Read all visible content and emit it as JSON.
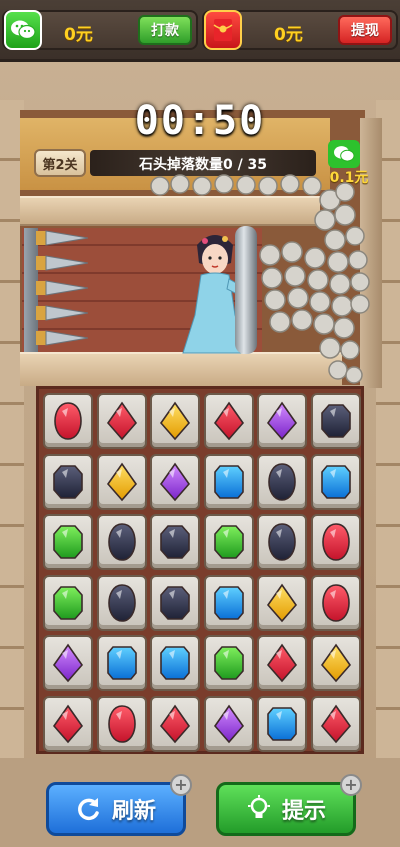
{
  "topbar": {
    "wechat_wallet": {
      "amount": "0元",
      "button": "打款",
      "icon": "wechat-icon"
    },
    "redpacket_wallet": {
      "amount": "0元",
      "button": "提现",
      "icon": "red-envelope-icon"
    }
  },
  "hud": {
    "timer": "00:50",
    "level": "第2关",
    "progress_label": "石头掉落数量0 / 35",
    "bonus_value": "0.1元",
    "bonus_icon": "wechat-icon"
  },
  "board": {
    "rows": [
      [
        "red-oval",
        "red-diamond",
        "yellow-diamond",
        "red-diamond",
        "purple-diamond",
        "dark-octagon"
      ],
      [
        "dark-octagon",
        "yellow-diamond",
        "purple-diamond",
        "blue-square",
        "dark-oval",
        "blue-square"
      ],
      [
        "green-octagon",
        "dark-oval",
        "dark-octagon",
        "green-octagon",
        "dark-oval",
        "red-oval"
      ],
      [
        "green-octagon",
        "dark-oval",
        "dark-octagon",
        "blue-square",
        "yellow-diamond",
        "red-oval"
      ],
      [
        "purple-diamond",
        "blue-square",
        "blue-square",
        "green-octagon",
        "red-diamond",
        "yellow-diamond"
      ],
      [
        "red-diamond",
        "red-oval",
        "red-diamond",
        "purple-diamond",
        "blue-square",
        "red-diamond"
      ]
    ]
  },
  "gem_colors": {
    "red": [
      "#ff5c6a",
      "#c4132b"
    ],
    "yellow": [
      "#ffe066",
      "#e39b00"
    ],
    "purple": [
      "#d38cff",
      "#7a24c9"
    ],
    "blue": [
      "#5fd0ff",
      "#0a6fd6"
    ],
    "green": [
      "#7eef5c",
      "#1e9a1e"
    ],
    "dark": [
      "#5b5f7a",
      "#1f2236"
    ]
  },
  "actions": {
    "refresh_label": "刷新",
    "hint_label": "提示",
    "refresh_icon": "refresh-icon",
    "hint_icon": "lightbulb-icon"
  }
}
